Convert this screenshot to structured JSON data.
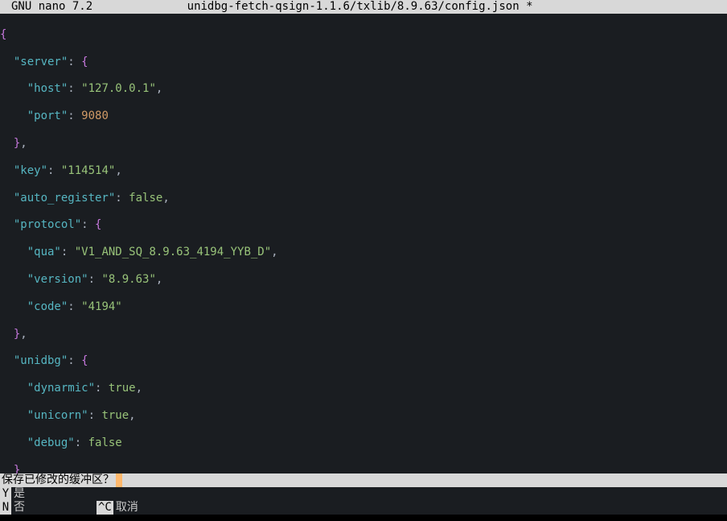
{
  "titlebar": {
    "app": "GNU nano 7.2",
    "filename": "unidbg-fetch-qsign-1.1.6/txlib/8.9.63/config.json *"
  },
  "json_content": {
    "server": {
      "host": "127.0.0.1",
      "port": 9080
    },
    "key": "114514",
    "auto_register": false,
    "protocol": {
      "qua": "V1_AND_SQ_8.9.63_4194_YYB_D",
      "version": "8.9.63",
      "code": "4194"
    },
    "unidbg": {
      "dynarmic": true,
      "unicorn": true,
      "debug": false
    }
  },
  "tokens": {
    "k_server": "\"server\"",
    "k_host": "\"host\"",
    "v_host": "\"127.0.0.1\"",
    "k_port": "\"port\"",
    "v_port": "9080",
    "k_key": "\"key\"",
    "v_key": "\"114514\"",
    "k_auto_register": "\"auto_register\"",
    "v_false": "false",
    "k_protocol": "\"protocol\"",
    "k_qua": "\"qua\"",
    "v_qua": "\"V1_AND_SQ_8.9.63_4194_YYB_D\"",
    "k_version": "\"version\"",
    "v_version": "\"8.9.63\"",
    "k_code": "\"code\"",
    "v_code": "\"4194\"",
    "k_unidbg": "\"unidbg\"",
    "k_dynarmic": "\"dynarmic\"",
    "v_true": "true",
    "k_unicorn": "\"unicorn\"",
    "k_debug": "\"debug\""
  },
  "prompt": {
    "text": "保存已修改的缓冲区？"
  },
  "shortcuts": {
    "yes_key": " Y",
    "yes_label": "是",
    "no_key": " N",
    "no_label": "否",
    "cancel_key": "^C",
    "cancel_label": "取消"
  }
}
